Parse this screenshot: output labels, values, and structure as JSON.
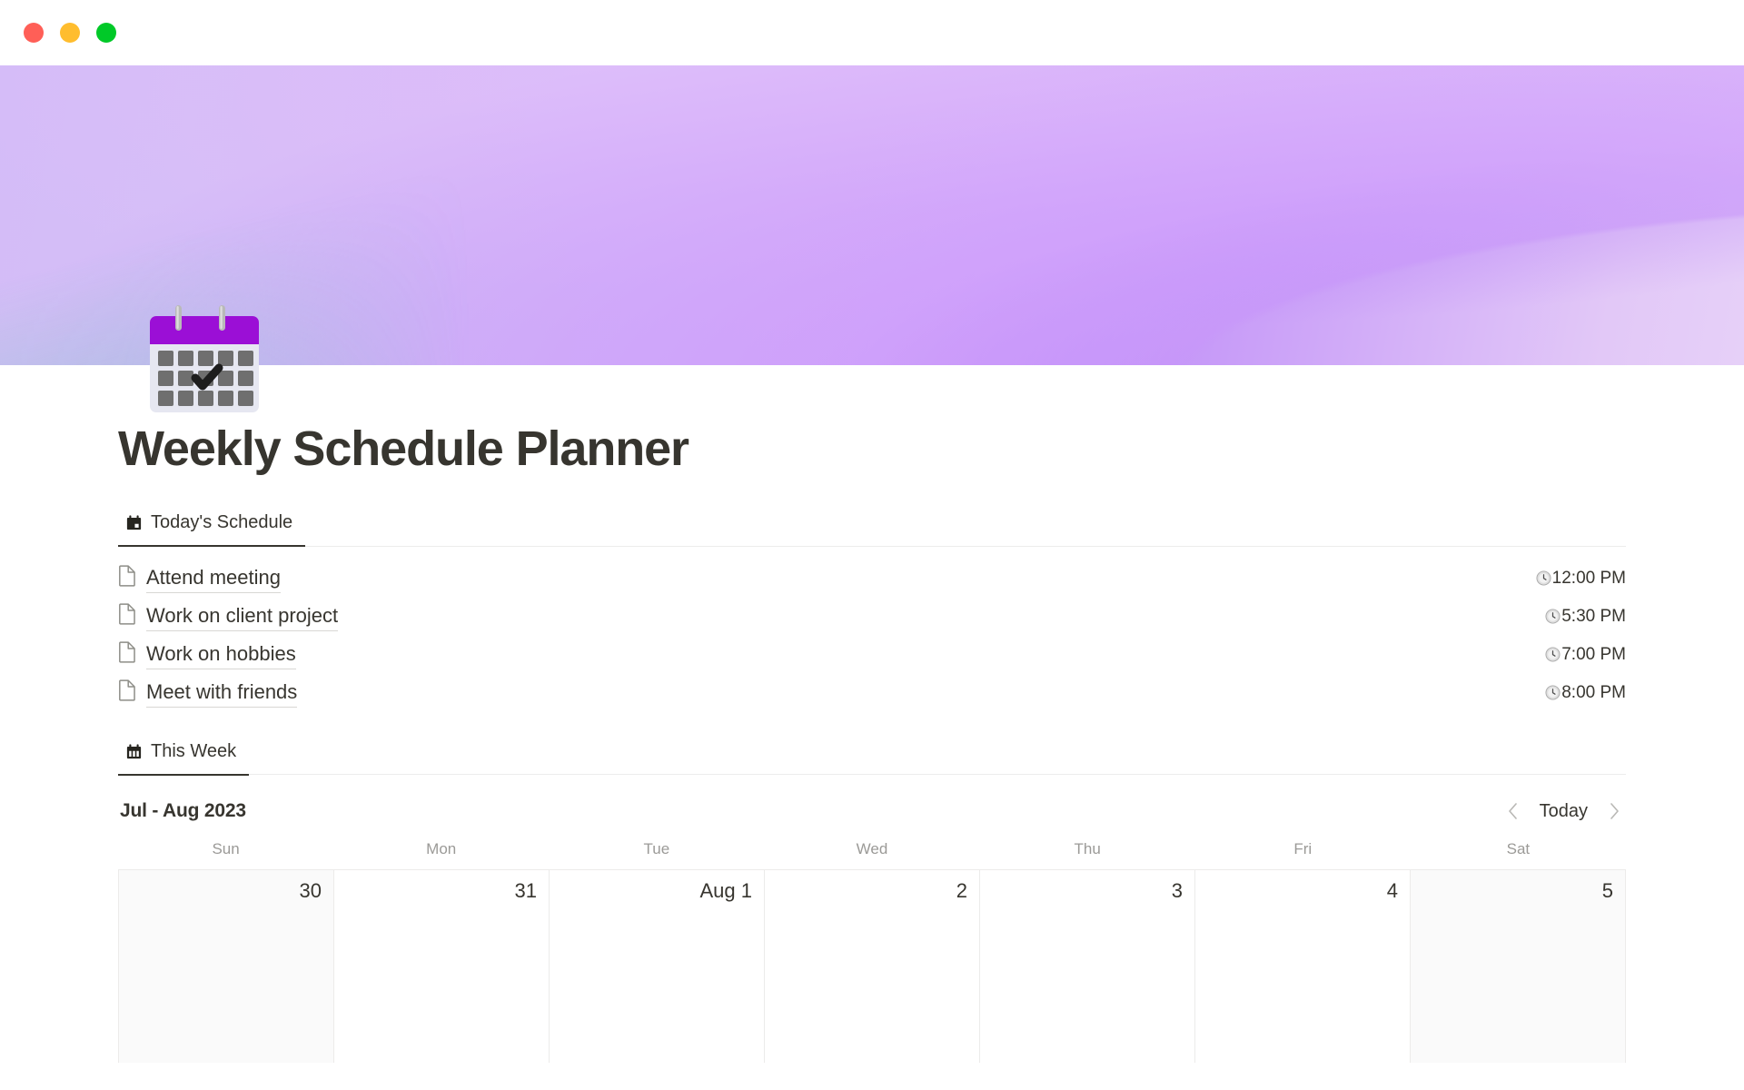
{
  "window": {
    "traffic_lights": [
      {
        "name": "close",
        "color": "#ff5f57"
      },
      {
        "name": "minimize",
        "color": "#ffbd2e"
      },
      {
        "name": "maximize",
        "color": "#00c928"
      }
    ]
  },
  "cover": {
    "gradient_colors": [
      "#4f74de",
      "#5fd3b2",
      "#9a74f0",
      "#bb86f8",
      "#e2c8f7"
    ]
  },
  "page": {
    "icon": "spiral-calendar-emoji",
    "title": "Weekly Schedule Planner"
  },
  "tabs": [
    {
      "id": "today",
      "icon": "calendar-day-icon",
      "label": "Today's Schedule",
      "active": true
    },
    {
      "id": "week",
      "icon": "calendar-week-icon",
      "label": "This Week",
      "active": true
    }
  ],
  "todays_schedule": {
    "items": [
      {
        "icon": "page-icon",
        "name": "Attend meeting",
        "time_icon": "clock-emoji",
        "time": "12:00 PM"
      },
      {
        "icon": "page-icon",
        "name": "Work on client project",
        "time_icon": "clock-emoji",
        "time": "5:30 PM"
      },
      {
        "icon": "page-icon",
        "name": "Work on hobbies",
        "time_icon": "clock-emoji",
        "time": "7:00 PM"
      },
      {
        "icon": "page-icon",
        "name": "Meet with friends",
        "time_icon": "clock-emoji",
        "time": "8:00 PM"
      }
    ]
  },
  "calendar": {
    "month_label": "Jul - Aug 2023",
    "nav": {
      "prev_icon": "chevron-left-icon",
      "today_label": "Today",
      "next_icon": "chevron-right-icon"
    },
    "day_headers": [
      "Sun",
      "Mon",
      "Tue",
      "Wed",
      "Thu",
      "Fri",
      "Sat"
    ],
    "cells": [
      {
        "label": "30",
        "weekend": true
      },
      {
        "label": "31",
        "weekend": false
      },
      {
        "label": "Aug 1",
        "weekend": false
      },
      {
        "label": "2",
        "weekend": false
      },
      {
        "label": "3",
        "weekend": false
      },
      {
        "label": "4",
        "weekend": false
      },
      {
        "label": "5",
        "weekend": true
      }
    ]
  }
}
